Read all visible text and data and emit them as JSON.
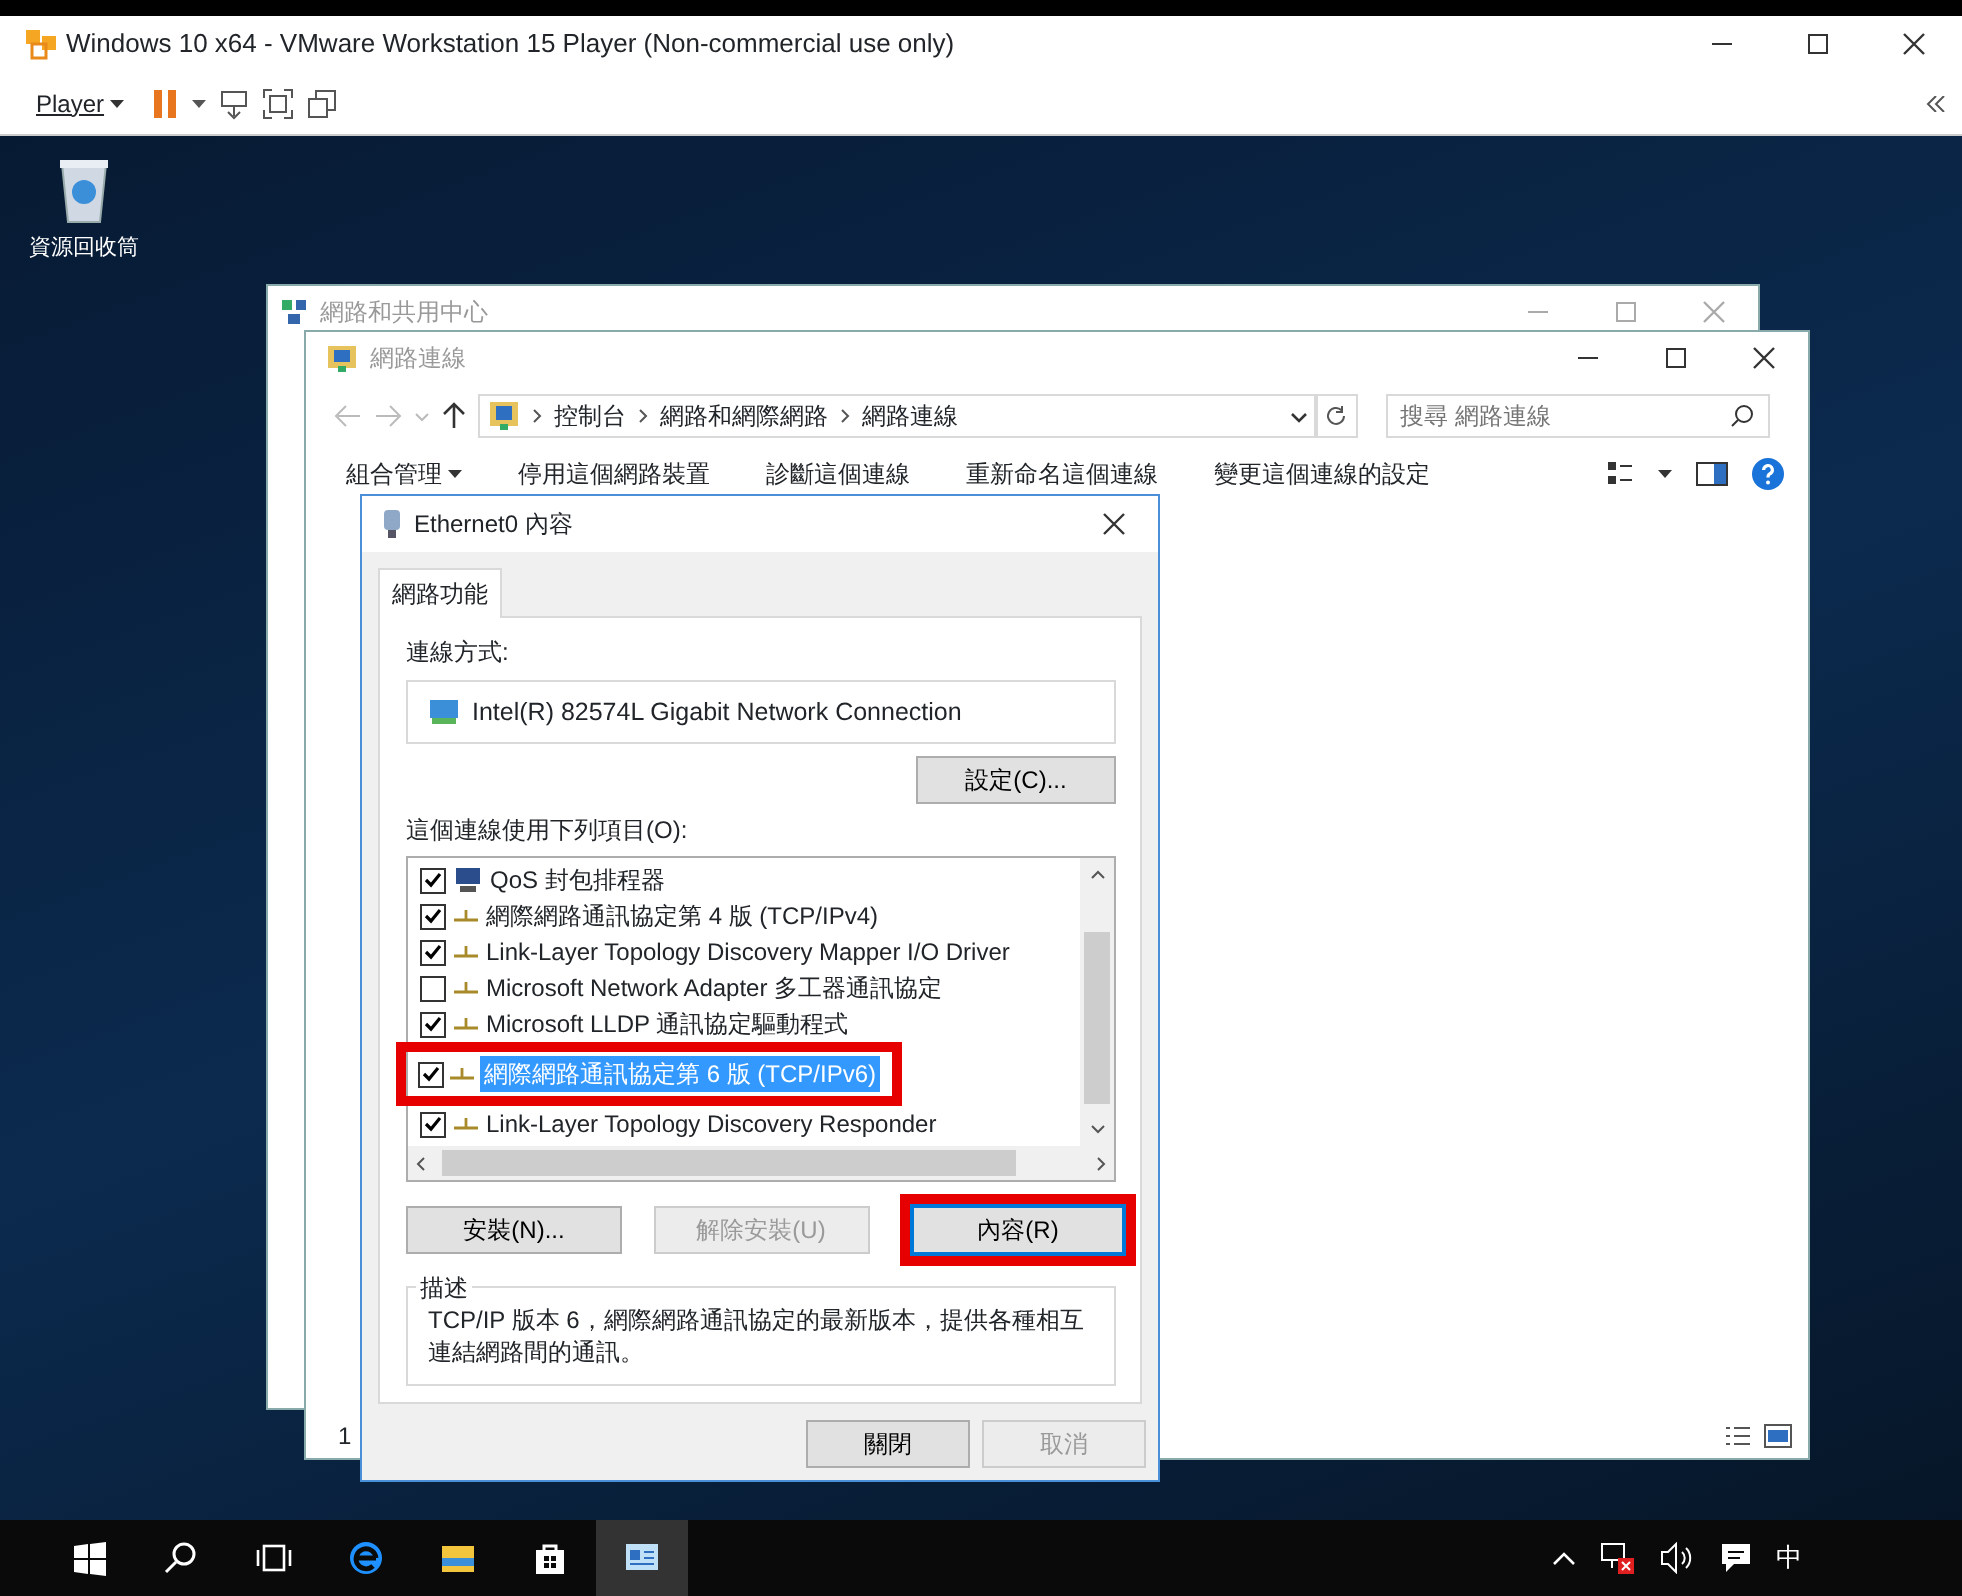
{
  "vm_window": {
    "title": "Windows 10 x64 - VMware Workstation 15 Player (Non-commercial use only)",
    "menu": "Player"
  },
  "desktop_icons": [
    {
      "label": "資源回收筒"
    }
  ],
  "back_window": {
    "title": "網路和共用中心"
  },
  "explorer": {
    "title": "網路連線",
    "breadcrumb": [
      "控制台",
      "網路和網際網路",
      "網路連線"
    ],
    "search": {
      "placeholder": "搜尋 網路連線"
    },
    "toolbar": [
      {
        "label": "組合管理",
        "kind": "menu"
      },
      {
        "label": "停用這個網路裝置",
        "kind": "command"
      },
      {
        "label": "診斷這個連線",
        "kind": "command"
      },
      {
        "label": "重新命名這個連線",
        "kind": "command"
      },
      {
        "label": "變更這個連線的設定",
        "kind": "command"
      }
    ],
    "status": "1"
  },
  "dialog": {
    "title": "Ethernet0 內容",
    "tabs": [
      {
        "label": "網路功能",
        "selected": true
      }
    ],
    "connect_label": "連線方式:",
    "adapter": "Intel(R) 82574L Gigabit Network Connection",
    "configure_button": "設定(C)...",
    "items_label": "這個連線使用下列項目(O):",
    "items": [
      {
        "label": "QoS 封包排程器",
        "kind": "service",
        "checked": true,
        "selected": false,
        "highlighted": false
      },
      {
        "label": "網際網路通訊協定第 4 版 (TCP/IPv4)",
        "kind": "protocol",
        "checked": true,
        "selected": false,
        "highlighted": false
      },
      {
        "label": "Link-Layer Topology Discovery Mapper I/O Driver",
        "kind": "protocol",
        "checked": true,
        "selected": false,
        "highlighted": false
      },
      {
        "label": "Microsoft Network Adapter 多工器通訊協定",
        "kind": "protocol",
        "checked": false,
        "selected": false,
        "highlighted": false
      },
      {
        "label": "Microsoft LLDP 通訊協定驅動程式",
        "kind": "protocol",
        "checked": true,
        "selected": false,
        "highlighted": false
      },
      {
        "label": "網際網路通訊協定第 6 版 (TCP/IPv6)",
        "kind": "protocol",
        "checked": true,
        "selected": true,
        "highlighted": true
      },
      {
        "label": "Link-Layer Topology Discovery Responder",
        "kind": "protocol",
        "checked": true,
        "selected": false,
        "highlighted": false
      }
    ],
    "buttons": [
      {
        "label": "安裝(N)...",
        "disabled": false,
        "highlighted": false
      },
      {
        "label": "解除安裝(U)",
        "disabled": true,
        "highlighted": false
      },
      {
        "label": "內容(R)",
        "disabled": false,
        "highlighted": true
      }
    ],
    "description_title": "描述",
    "description": "TCP/IP 版本 6，網際網路通訊協定的最新版本，提供各種相互連結網路間的通訊。",
    "footer_buttons": [
      {
        "label": "關閉",
        "disabled": false
      },
      {
        "label": "取消",
        "disabled": true
      }
    ]
  },
  "taskbar": {
    "ime": "中"
  }
}
